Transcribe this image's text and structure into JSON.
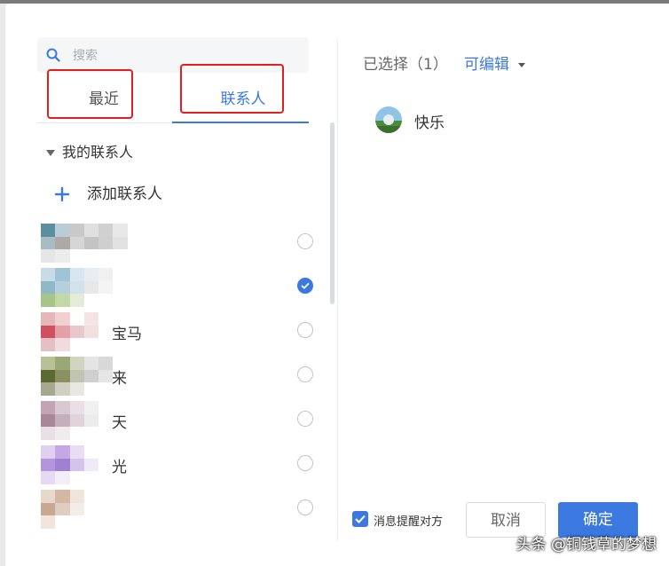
{
  "search": {
    "placeholder": "搜索"
  },
  "tabs": [
    {
      "label": "最近",
      "active": false
    },
    {
      "label": "联系人",
      "active": true
    }
  ],
  "group": {
    "label": "我的联系人"
  },
  "add_contact": {
    "label": "添加联系人"
  },
  "contacts": [
    {
      "name": "",
      "checked": false
    },
    {
      "name": "",
      "checked": true
    },
    {
      "name": "宝马",
      "checked": false
    },
    {
      "name": "来",
      "checked": false
    },
    {
      "name": "天",
      "checked": false
    },
    {
      "name": "光",
      "checked": false
    },
    {
      "name": "",
      "checked": false
    }
  ],
  "selection": {
    "title": "已选择（1）",
    "mode": "可编辑",
    "selected": [
      {
        "name": "快乐"
      }
    ]
  },
  "footer": {
    "notify_label": "消息提醒对方",
    "notify_checked": true,
    "cancel_label": "取消",
    "confirm_label": "确定"
  },
  "watermark": "头条 @铜钱草的梦想",
  "colors": {
    "accent": "#3b79e0",
    "annotation": "#e41e1e"
  }
}
